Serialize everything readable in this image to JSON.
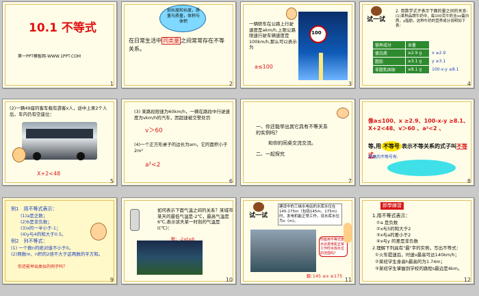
{
  "slides": [
    {
      "num": "1",
      "title": "10.1 不等式",
      "footer": "第一PPT模板网-WWW.1PPT.COM"
    },
    {
      "num": "2",
      "bubble": "如长度和长度，质量与质量，体积与体积",
      "line1_pre": "在日常生活中",
      "line1_hl": "同类量",
      "line1_post": "之间常常存在不等",
      "line2": "关系。"
    },
    {
      "num": "3",
      "sign": "100",
      "text": "一辆轿车在公路上行驶速度是akm/h,上限公路限速行驶车辆速度是100km/h,那么可以表示为",
      "answer": "a≤100"
    },
    {
      "num": "4",
      "try_label": "试一试",
      "heading": "2. 用数学式子表示下面的量之间的关系:",
      "sub": "(1)某种品牌牛奶中，每100克牛奶含xx蛋白质，y脂肪，这种牛奶的营养成分说明如下表：",
      "table_header": [
        "营养成分",
        "含量"
      ],
      "rows": [
        {
          "label": "蛋白质",
          "val": "≥2.9 g",
          "expr": "x ≥2.9"
        },
        {
          "label": "脂肪",
          "val": "≥3.1 g",
          "expr": "y ≥3.1"
        },
        {
          "label": "非脂乳固体",
          "val": "≥8.1 g",
          "expr": "100-x-y ≥8.1"
        }
      ]
    },
    {
      "num": "5",
      "text": "(2)一辆49座的客车载有游客x人，途中上来2个人后，车内仍有空座位：",
      "answer": "X+2<48"
    },
    {
      "num": "6",
      "p1": "(3) 某路段限速为60km/h，一辆在路段中行驶速度为vkm/h的汽车，因超速被交警处罚",
      "a1": "v＞60",
      "p2": "(4)一个正方形桌子的边长为am，它的面积小于2m²",
      "a2": "a²<2"
    },
    {
      "num": "7",
      "l1": "一、你还能举出其它具有不等关系的实例吗？",
      "l2": "和你的同桌交流交流。",
      "l3": "二、一起探究"
    },
    {
      "num": "8",
      "line1": "像a≤100、x ≥2.9、100-x-y ≥8.1、X+2<48、v＞60 、a²<2 、",
      "line2_pre": "等,用",
      "badge": "不等号",
      "line2_mid": "表示不等关系的式子叫",
      "line2_end": "不等式",
      "line2_dot": "。",
      "note": "常见的不等号有:"
    },
    {
      "num": "9",
      "ex1": "例1　用不等式表示：",
      "items": [
        "(1)a是正数；",
        "(2)b是非负数；",
        "(3)x的一半小于-1；",
        "(4)y与4的和大于0.5。"
      ],
      "ex2": "例2　列不等式：",
      "q1": "(1) 一个数n的绝对值不小于0。",
      "q2": "(2)两数m、n积的2倍不大于这两数的平方和。",
      "hint": "你还能举出类似的例子吗？"
    },
    {
      "num": "10",
      "text": "如何表示下面气温之间的关系？某城市某天的最低气温是-2℃，最高气温是6℃,表示该天某一时刻的气温是t(℃)：",
      "answer": "解：-2≤t≤6"
    },
    {
      "num": "11",
      "try_label": "试一试",
      "box": "建设中的三峡水电站的水库水位在145-175m（包括145m、175m)时，发电机能正常工作，设水库水位为x（m)。",
      "speech": "你能用不等式表示出发电机正常工作时水库水位的范围吗？",
      "answer": "解:145 ≤x ≤175"
    },
    {
      "num": "12",
      "tag": "即學練習",
      "title": "1.用不等式表示：",
      "items": [
        "①a 是负数",
        "②x与5的和大于2",
        "③x与a的差小于2",
        "④x与y 的差是非负数"
      ],
      "q2": "2.理解下列具有\"最\"字的实例，写出不等式：",
      "q2items": [
        "①火车提速后，时速v最高可达140km/h；",
        "②某班学生身高h最高的为1.74m；",
        "③某班学生掌握到学校的路程s最远是4km。"
      ]
    }
  ]
}
